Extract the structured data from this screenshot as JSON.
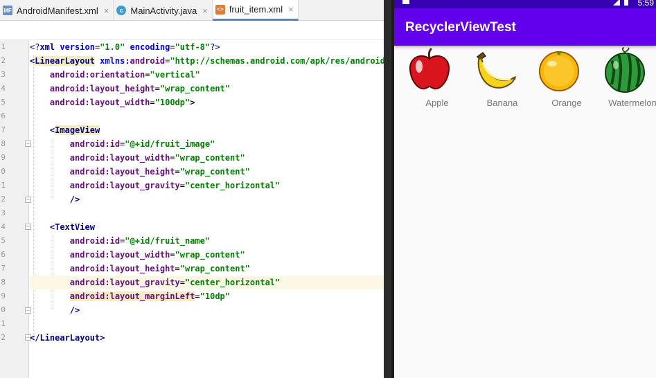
{
  "editor": {
    "tabs": [
      {
        "label": "AndroidManifest.xml",
        "icon": "manifest-file-icon",
        "active": false
      },
      {
        "label": "MainActivity.java",
        "icon": "java-class-icon",
        "active": false
      },
      {
        "label": "fruit_item.xml",
        "icon": "xml-layout-file-icon",
        "active": true
      }
    ],
    "close_glyph": "×",
    "line_numbers": [
      "1",
      "2",
      "3",
      "4",
      "5",
      "6",
      "7",
      "8",
      "9",
      "0",
      "1",
      "2",
      "3",
      "4",
      "5",
      "6",
      "7",
      "8",
      "9",
      "0",
      "1",
      "2"
    ],
    "code": {
      "l1": {
        "pi_open": "<?",
        "xml": "xml ",
        "version_attr": "version",
        "eq1": "=",
        "version_val": "\"1.0\"",
        "sp": " ",
        "enc_attr": "encoding",
        "eq2": "=",
        "enc_val": "\"utf-8\"",
        "pi_close": "?>"
      },
      "l2": {
        "lt": "<",
        "tag": "LinearLayout",
        "sp": " ",
        "ns_prefix": "xmlns:",
        "ns_name": "android",
        "eq": "=",
        "ns_val": "\"http://schemas.android.com/apk/res/android\""
      },
      "l3": {
        "indent": "    ",
        "attr": "android:orientation",
        "eq": "=",
        "val": "\"vertical\""
      },
      "l4": {
        "indent": "    ",
        "attr": "android:layout_height",
        "eq": "=",
        "val": "\"wrap_content\""
      },
      "l5": {
        "indent": "    ",
        "attr": "android:layout_width",
        "eq": "=",
        "val": "\"100dp\"",
        "end": ">"
      },
      "l7": {
        "indent": "    ",
        "lt": "<",
        "tag": "ImageView"
      },
      "l8": {
        "indent": "        ",
        "attr": "android:id",
        "eq": "=",
        "val": "\"@+id/fruit_image\""
      },
      "l9": {
        "indent": "        ",
        "attr": "android:layout_width",
        "eq": "=",
        "val": "\"wrap_content\""
      },
      "l10": {
        "indent": "        ",
        "attr": "android:layout_height",
        "eq": "=",
        "val": "\"wrap_content\""
      },
      "l11": {
        "indent": "        ",
        "attr": "android:layout_gravity",
        "eq": "=",
        "val": "\"center_horizontal\""
      },
      "l12": {
        "indent": "        ",
        "close": "/>"
      },
      "l14": {
        "indent": "    ",
        "lt": "<",
        "tag": "TextView"
      },
      "l15": {
        "indent": "        ",
        "attr": "android:id",
        "eq": "=",
        "val": "\"@+id/fruit_name\""
      },
      "l16": {
        "indent": "        ",
        "attr": "android:layout_width",
        "eq": "=",
        "val": "\"wrap_content\""
      },
      "l17": {
        "indent": "        ",
        "attr": "android:layout_height",
        "eq": "=",
        "val": "\"wrap_content\""
      },
      "l18": {
        "indent": "        ",
        "attr": "android:layout_gravity",
        "eq": "=",
        "val": "\"center_horizontal\""
      },
      "l19": {
        "indent": "        ",
        "attr": "android:layout_marginLeft",
        "eq": "=",
        "val": "\"10dp\""
      },
      "l20": {
        "indent": "        ",
        "close": "/>"
      },
      "l22": {
        "lt": "</",
        "tag": "LinearLayout",
        "gt": ">"
      }
    }
  },
  "phone": {
    "status_time": "5:59",
    "app_title": "RecyclerViewTest",
    "fruits": [
      {
        "name": "Apple",
        "icon": "apple-icon"
      },
      {
        "name": "Banana",
        "icon": "banana-icon"
      },
      {
        "name": "Orange",
        "icon": "orange-icon"
      },
      {
        "name": "Watermelon",
        "icon": "watermelon-icon"
      }
    ]
  },
  "colors": {
    "status_bar": "#3700b3",
    "app_bar": "#6200ee",
    "tag": "#000080",
    "attribute": "#660e7a",
    "string": "#008000",
    "namespace": "#0000ff"
  }
}
